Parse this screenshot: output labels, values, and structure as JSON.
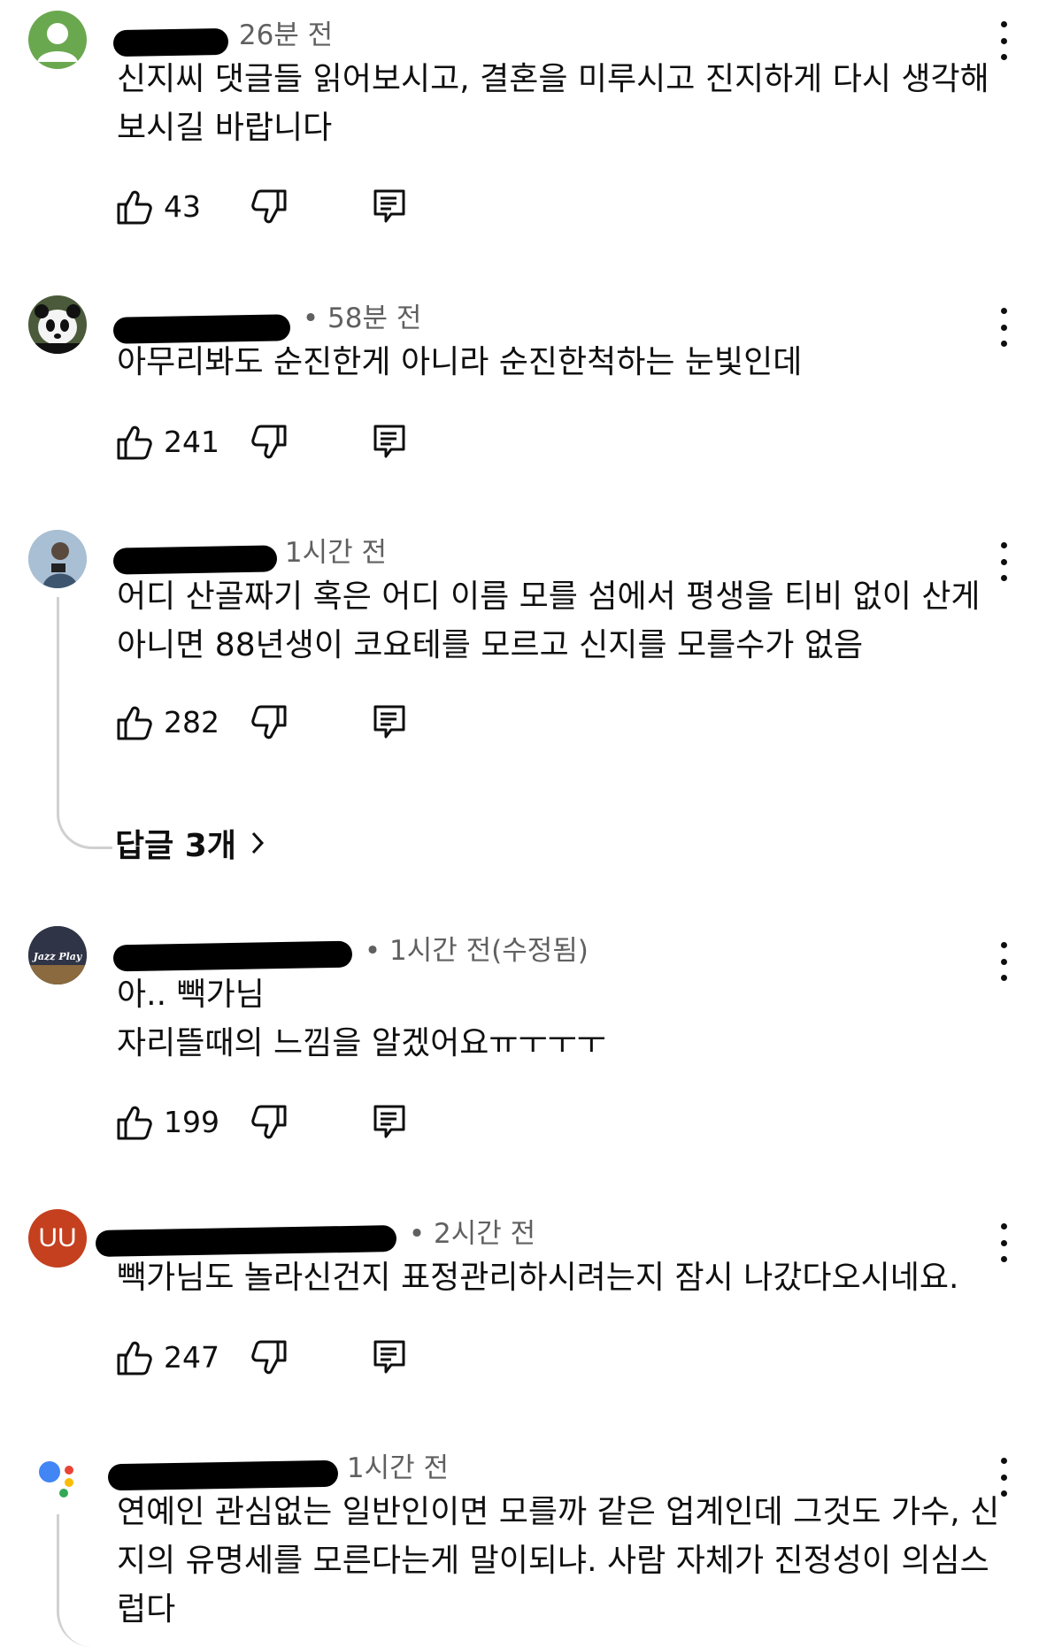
{
  "comments": [
    {
      "time": "26분 전",
      "text": "신지씨 댓글들 읽어보시고, 결혼을 미루시고 진지하게 다시 생각해\n보시길 바랍니다",
      "likes": "43",
      "avatar_color": "#6aa84f"
    },
    {
      "time": "58분 전",
      "text": "아무리봐도 순진한게 아니라 순진한척하는 눈빛인데",
      "likes": "241"
    },
    {
      "time": "1시간 전",
      "text": "어디 산골짜기 혹은 어디 이름 모를 섬에서 평생을 티비 없이 산게\n아니면 88년생이 코요테를 모르고 신지를 모를수가 없음",
      "likes": "282",
      "replies_label": "답글 3개"
    },
    {
      "time": "1시간 전(수정됨)",
      "text": "아.. 빽가님\n자리뜰때의 느낌을 알겠어요ㅠㅜㅜㅜ",
      "likes": "199",
      "avatar_label": "Jazz Play"
    },
    {
      "time": "2시간 전",
      "text": "빽가님도 놀라신건지 표정관리하시려는지 잠시 나갔다오시네요.",
      "likes": "247",
      "avatar_label": "UU",
      "avatar_color": "#c4401f"
    },
    {
      "time": "1시간 전",
      "text": "연예인 관심없는 일반인이면 모를까 같은 업계인데 그것도 가수, 신\n지의 유명세를 모른다는게 말이되냐. 사람 자체가 진정성이 의심스\n럽다"
    }
  ]
}
